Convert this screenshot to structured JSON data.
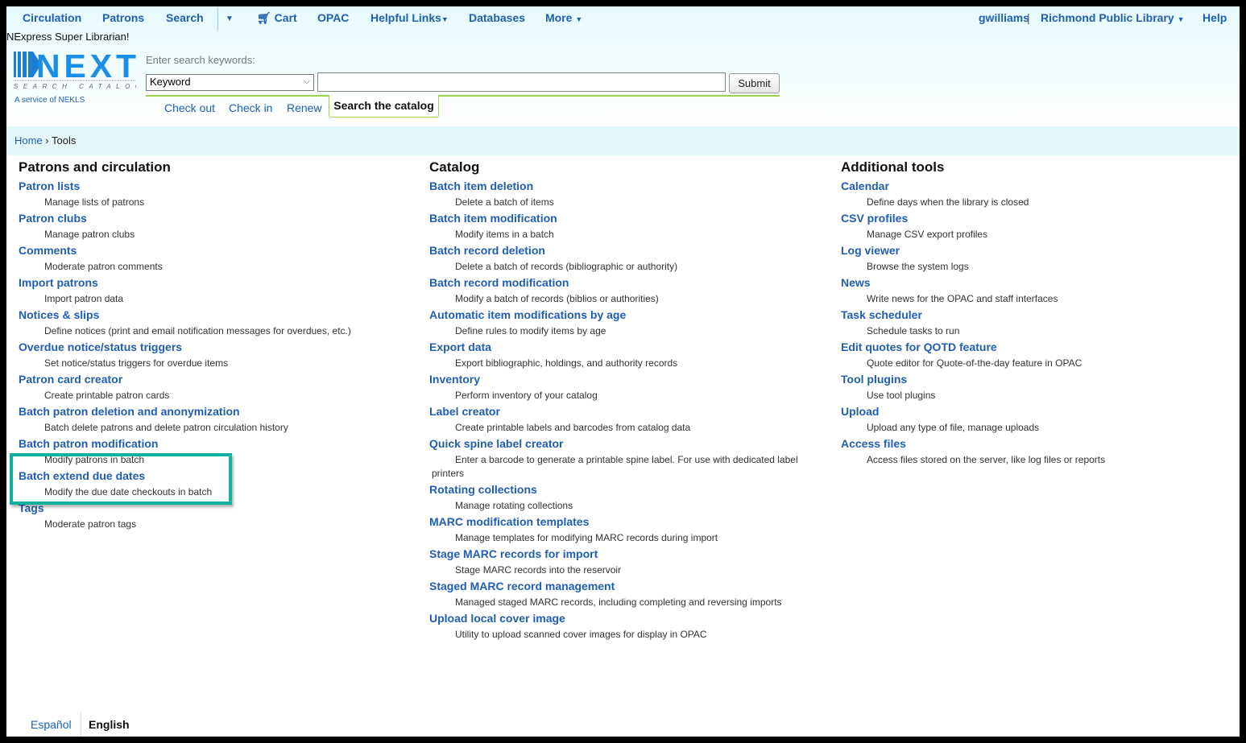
{
  "nav": {
    "left": [
      "Circulation",
      "Patrons",
      "Search",
      "Cart",
      "OPAC",
      "Helpful Links",
      "Databases",
      "More"
    ],
    "user": "gwilliams",
    "library": "Richmond Public Library",
    "help": "Help"
  },
  "tagline": "NExpress Super Librarian!",
  "logo": {
    "text": "NEXT",
    "sub": "SEARCH CATALOG",
    "service": "A service of NEKLS"
  },
  "search": {
    "label": "Enter search keywords:",
    "select": "Keyword",
    "value": "",
    "submit": "Submit",
    "tabs": [
      "Check out",
      "Check in",
      "Renew"
    ],
    "active_tab": "Search the catalog"
  },
  "breadcrumb": {
    "home": "Home",
    "current": "Tools"
  },
  "columns": [
    {
      "title": "Patrons and circulation",
      "items": [
        {
          "t": "Patron lists",
          "d": "Manage lists of patrons"
        },
        {
          "t": "Patron clubs",
          "d": "Manage patron clubs"
        },
        {
          "t": "Comments",
          "d": "Moderate patron comments"
        },
        {
          "t": "Import patrons",
          "d": "Import patron data"
        },
        {
          "t": "Notices & slips",
          "d": "Define notices (print and email notification messages for overdues, etc.)"
        },
        {
          "t": "Overdue notice/status triggers",
          "d": "Set notice/status triggers for overdue items"
        },
        {
          "t": "Patron card creator",
          "d": "Create printable patron cards"
        },
        {
          "t": "Batch patron deletion and anonymization",
          "d": "Batch delete patrons and delete patron circulation history"
        },
        {
          "t": "Batch patron modification",
          "d": "Modify patrons in batch"
        },
        {
          "t": "Batch extend due dates",
          "d": "Modify the due date checkouts in batch"
        },
        {
          "t": "Tags",
          "d": "Moderate patron tags"
        }
      ]
    },
    {
      "title": "Catalog",
      "items": [
        {
          "t": "Batch item deletion",
          "d": "Delete a batch of items"
        },
        {
          "t": "Batch item modification",
          "d": "Modify items in a batch"
        },
        {
          "t": "Batch record deletion",
          "d": "Delete a batch of records (bibliographic or authority)"
        },
        {
          "t": "Batch record modification",
          "d": "Modify a batch of records (biblios or authorities)"
        },
        {
          "t": "Automatic item modifications by age",
          "d": "Define rules to modify items by age"
        },
        {
          "t": "Export data",
          "d": "Export bibliographic, holdings, and authority records"
        },
        {
          "t": "Inventory",
          "d": "Perform inventory of your catalog"
        },
        {
          "t": "Label creator",
          "d": "Create printable labels and barcodes from catalog data"
        },
        {
          "t": "Quick spine label creator",
          "d": "Enter a barcode to generate a printable spine label. For use with dedicated label printers"
        },
        {
          "t": "Rotating collections",
          "d": "Manage rotating collections"
        },
        {
          "t": "MARC modification templates",
          "d": "Manage templates for modifying MARC records during import"
        },
        {
          "t": "Stage MARC records for import",
          "d": "Stage MARC records into the reservoir"
        },
        {
          "t": "Staged MARC record management",
          "d": "Managed staged MARC records, including completing and reversing imports"
        },
        {
          "t": "Upload local cover image",
          "d": "Utility to upload scanned cover images for display in OPAC"
        }
      ]
    },
    {
      "title": "Additional tools",
      "items": [
        {
          "t": "Calendar",
          "d": "Define days when the library is closed"
        },
        {
          "t": "CSV profiles",
          "d": "Manage CSV export profiles"
        },
        {
          "t": "Log viewer",
          "d": "Browse the system logs"
        },
        {
          "t": "News",
          "d": "Write news for the OPAC and staff interfaces"
        },
        {
          "t": "Task scheduler",
          "d": "Schedule tasks to run"
        },
        {
          "t": "Edit quotes for QOTD feature",
          "d": "Quote editor for Quote-of-the-day feature in OPAC"
        },
        {
          "t": "Tool plugins",
          "d": "Use tool plugins"
        },
        {
          "t": "Upload",
          "d": "Upload any type of file, manage uploads"
        },
        {
          "t": "Access files",
          "d": "Access files stored on the server, like log files or reports"
        }
      ]
    }
  ],
  "footer": {
    "languages": [
      "Español",
      "English"
    ],
    "current": "English"
  },
  "colors": {
    "link": "#1f5fb0",
    "highlight": "#12b09e",
    "band": "#e4f8fc"
  }
}
